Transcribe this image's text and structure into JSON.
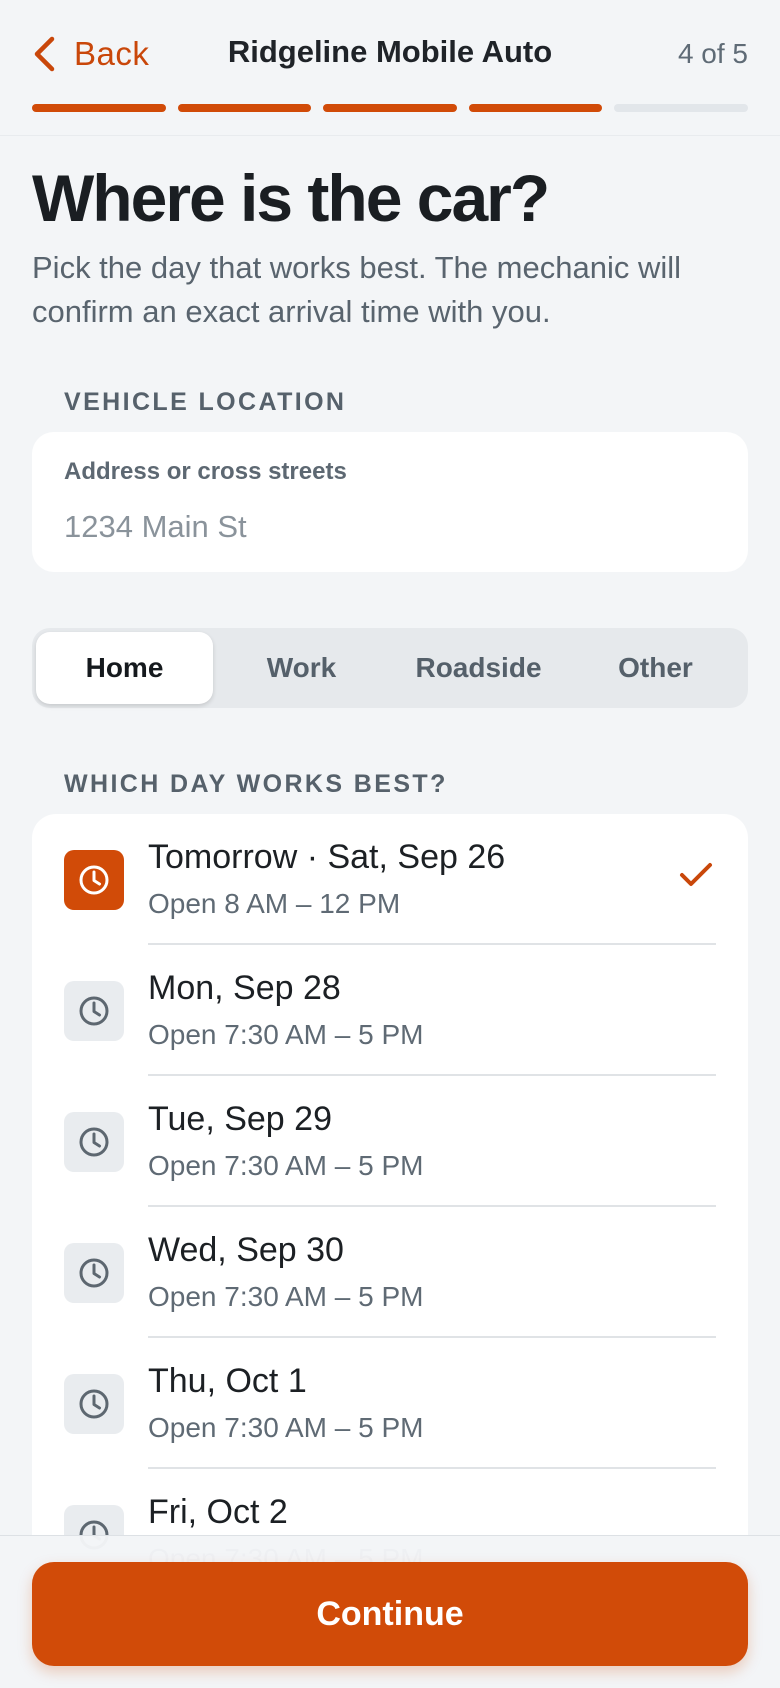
{
  "header": {
    "back_label": "Back",
    "title": "Ridgeline Mobile Auto",
    "step": "4 of 5",
    "progress_completed": 4,
    "progress_total": 5
  },
  "main": {
    "headline": "Where is the car?",
    "subcopy": "Pick the day that works best. The mechanic will confirm an exact arrival time with you.",
    "location_section_label": "VEHICLE LOCATION",
    "address": {
      "label": "Address or cross streets",
      "placeholder": "1234 Main St",
      "value": ""
    },
    "location_types": [
      {
        "label": "Home",
        "selected": true
      },
      {
        "label": "Work",
        "selected": false
      },
      {
        "label": "Roadside",
        "selected": false
      },
      {
        "label": "Other",
        "selected": false
      }
    ],
    "day_section_label": "WHICH DAY WORKS BEST?",
    "days": [
      {
        "title": "Tomorrow · Sat, Sep 26",
        "hours": "Open 8 AM – 12 PM",
        "selected": true
      },
      {
        "title": "Mon, Sep 28",
        "hours": "Open 7:30 AM – 5 PM",
        "selected": false
      },
      {
        "title": "Tue, Sep 29",
        "hours": "Open 7:30 AM – 5 PM",
        "selected": false
      },
      {
        "title": "Wed, Sep 30",
        "hours": "Open 7:30 AM – 5 PM",
        "selected": false
      },
      {
        "title": "Thu, Oct 1",
        "hours": "Open 7:30 AM – 5 PM",
        "selected": false
      },
      {
        "title": "Fri, Oct 2",
        "hours": "Open 7:30 AM – 5 PM",
        "selected": false
      }
    ]
  },
  "footer": {
    "continue_label": "Continue"
  },
  "icons": {
    "back": "chevron-left-icon",
    "day": "clock-icon",
    "selected": "checkmark-icon"
  },
  "colors": {
    "accent": "#d14b08",
    "background": "#f3f5f7",
    "card": "#ffffff",
    "progress_inactive": "#e2e6ea"
  }
}
